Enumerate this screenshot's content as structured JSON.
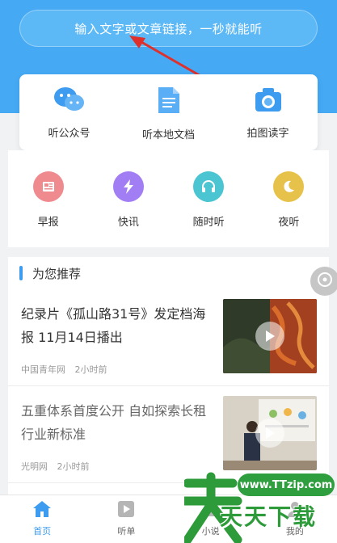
{
  "search": {
    "placeholder": "输入文字或文章链接，一秒就能听"
  },
  "main_actions": [
    {
      "label": "听公众号",
      "icon": "wechat-bubbles-icon"
    },
    {
      "label": "听本地文档",
      "icon": "document-icon"
    },
    {
      "label": "拍图读字",
      "icon": "camera-icon"
    }
  ],
  "quick_links": [
    {
      "label": "早报",
      "icon": "newspaper-icon",
      "color": "#ef8a8f"
    },
    {
      "label": "快讯",
      "icon": "lightning-icon",
      "color": "#a27ef4"
    },
    {
      "label": "随时听",
      "icon": "headphones-icon",
      "color": "#4cc5d2"
    },
    {
      "label": "夜听",
      "icon": "moon-icon",
      "color": "#e7c24a"
    }
  ],
  "feed": {
    "title": "为您推荐",
    "articles": [
      {
        "title": "纪录片《孤山路31号》发定档海报 11月14日播出",
        "source": "中国青年网",
        "time": "2小时前"
      },
      {
        "title": "五重体系首度公开 自如探索长租行业新标准",
        "source": "光明网",
        "time": "2小时前"
      }
    ]
  },
  "tabbar": {
    "tabs": [
      {
        "label": "首页",
        "icon": "home-icon",
        "active": true
      },
      {
        "label": "听单",
        "icon": "playlist-icon"
      },
      {
        "label": "小说",
        "icon": "book-icon"
      },
      {
        "label": "我的",
        "icon": "user-icon"
      }
    ]
  },
  "watermark": {
    "url": "www.TTzip.com",
    "text": "天天下载"
  },
  "colors": {
    "accent": "#3d9cf0",
    "header": "#45a9f4"
  }
}
